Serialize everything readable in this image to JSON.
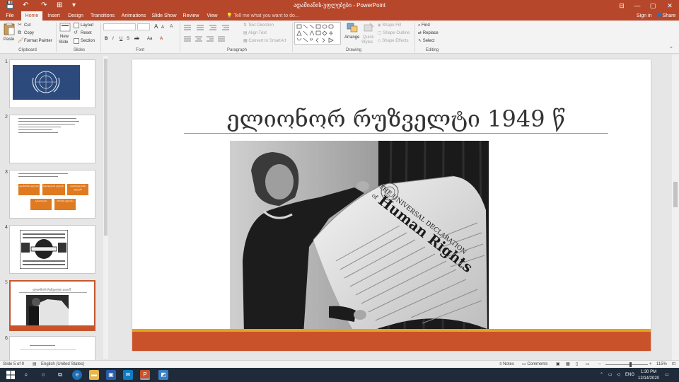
{
  "window": {
    "title": "ადამიანის-უფლებები - PowerPoint",
    "quick_access": [
      "💾",
      "↶",
      "↷",
      "⊞",
      "▾"
    ],
    "controls": [
      "⊟",
      "—",
      "▢",
      "✕"
    ]
  },
  "tabs": [
    "File",
    "Home",
    "Insert",
    "Design",
    "Transitions",
    "Animations",
    "Slide Show",
    "Review",
    "View"
  ],
  "tell_me": "Tell me what you want to do...",
  "account": {
    "signin": "Sign in",
    "share": "Share"
  },
  "ribbon": {
    "clipboard": {
      "label": "Clipboard",
      "paste": "Paste",
      "cut": "Cut",
      "copy": "Copy",
      "format_painter": "Format Painter"
    },
    "slides": {
      "label": "Slides",
      "new_slide": "New",
      "new_slide2": "Slide",
      "layout": "Layout",
      "reset": "Reset",
      "section": "Section"
    },
    "font": {
      "label": "Font",
      "bold": "B",
      "italic": "I",
      "underline": "U",
      "strike": "S",
      "spacing": "ab",
      "size_up": "A",
      "size_down": "A",
      "clear": "A",
      "case": "Aa",
      "color": "A"
    },
    "paragraph": {
      "label": "Paragraph",
      "text_direction": "Text Direction",
      "align_text": "Align Text",
      "smartart": "Convert to SmartArt"
    },
    "drawing": {
      "label": "Drawing",
      "arrange": "Arrange",
      "quick_styles": "Quick",
      "quick_styles2": "Styles",
      "fill": "Shape Fill",
      "outline": "Shape Outline",
      "effects": "Shape Effects"
    },
    "editing": {
      "label": "Editing",
      "find": "Find",
      "replace": "Replace",
      "select": "Select"
    }
  },
  "thumbnails": [
    {
      "number": "1"
    },
    {
      "number": "2"
    },
    {
      "number": "3",
      "boxes": [
        "ადამიანის უფლება",
        "სიცოცხლის უფლება",
        "თავისუფლების უფლება",
        "განათლება",
        "შრომის უფლება"
      ]
    },
    {
      "number": "4"
    },
    {
      "number": "5",
      "title": "ელიონორ რუზველტი 1949 წ"
    },
    {
      "number": "6"
    }
  ],
  "slide": {
    "title": "ელიონორ რუზველტი 1949 წ",
    "poster": {
      "line1": "THE UNIVERSAL DECLARATION",
      "line2": "of",
      "line3": "Human Rights"
    }
  },
  "status": {
    "slide_of": "Slide 5 of 9",
    "language": "English (United States)",
    "notes": "Notes",
    "comments": "Comments",
    "zoom": "115%"
  },
  "taskbar": {
    "time": "1:30 PM",
    "date": "12/14/2020",
    "lang": "ENG"
  },
  "colors": {
    "accent": "#b7472a",
    "footer_bar": "#c9522b",
    "footer_stripe": "#e7a11a",
    "thumb_box": "#e07a20"
  }
}
